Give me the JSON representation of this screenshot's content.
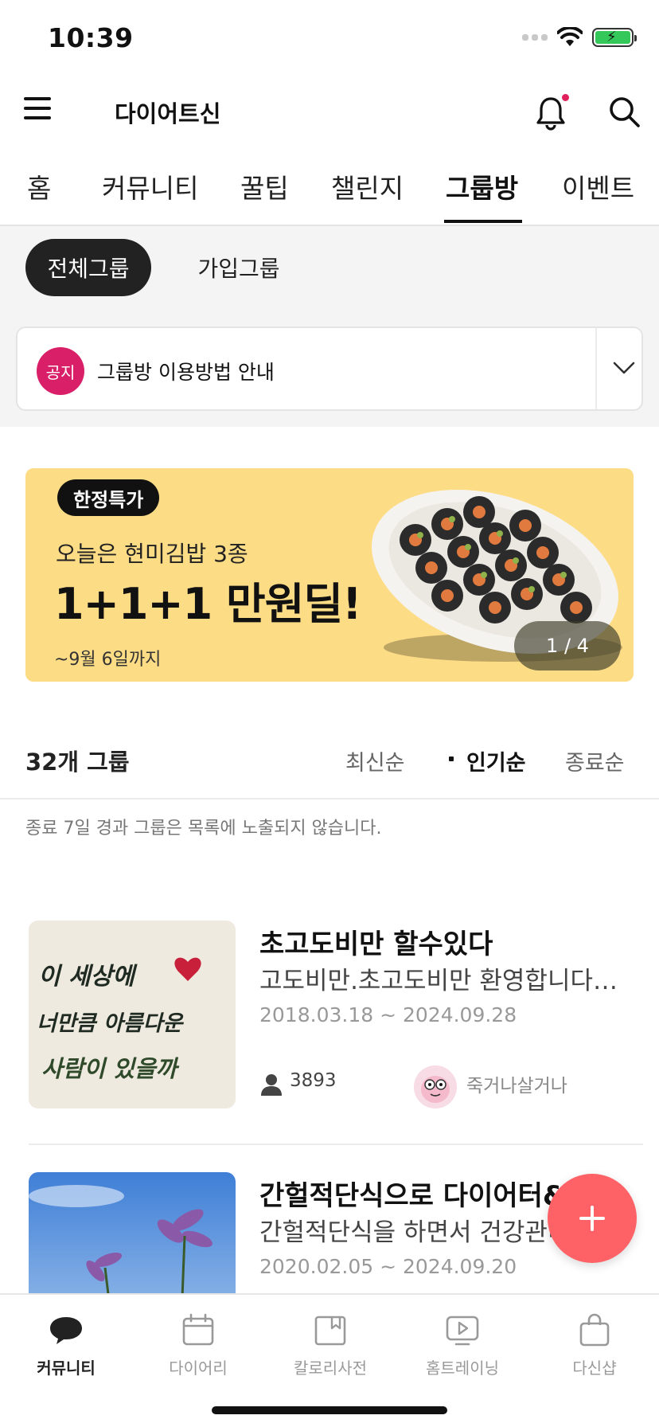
{
  "status_bar": {
    "time": "10:39"
  },
  "header": {
    "app_title": "다이어트신"
  },
  "main_tabs": [
    {
      "label": "홈"
    },
    {
      "label": "커뮤니티"
    },
    {
      "label": "꿀팁"
    },
    {
      "label": "챌린지"
    },
    {
      "label": "그룹방",
      "active": true
    },
    {
      "label": "이벤트"
    }
  ],
  "sub_tabs": [
    {
      "label": "전체그룹",
      "active": true
    },
    {
      "label": "가입그룹"
    }
  ],
  "notice": {
    "badge": "공지",
    "text": "그룹방 이용방법 안내"
  },
  "banner": {
    "tag": "한정특가",
    "subtitle": "오늘은 현미김밥 3종",
    "headline": "1+1+1 만원딜!",
    "date": "~9월 6일까지",
    "pager": "1 / 4",
    "color": "#fddc86"
  },
  "list": {
    "count": "32개 그룹",
    "sort_options": [
      {
        "label": "최신순"
      },
      {
        "label": "인기순",
        "active": true
      },
      {
        "label": "종료순"
      }
    ],
    "note": "종료 7일 경과 그룹은 목록에 노출되지 않습니다.",
    "groups": [
      {
        "title": "초고도비만 할수있다",
        "description": "고도비만.초고도비만 환영합니다…",
        "period": "2018.03.18 ~ 2024.09.28",
        "members": "3893",
        "owner": "죽거나살거나",
        "thumb_text": [
          "이 세상에",
          "너만큼 아름다운",
          "사람이 있을까"
        ]
      },
      {
        "title": "간헐적단식으로 다이어터&",
        "description": "간헐적단식을 하면서 건강관리",
        "period": "2020.02.05 ~ 2024.09.20"
      }
    ]
  },
  "fab": {
    "icon": "plus-icon",
    "color": "#ff6266"
  },
  "bottom_nav": [
    {
      "label": "커뮤니티",
      "icon": "chat-bubble-icon",
      "active": true
    },
    {
      "label": "다이어리",
      "icon": "calendar-icon"
    },
    {
      "label": "칼로리사전",
      "icon": "book-icon"
    },
    {
      "label": "홈트레이닝",
      "icon": "play-icon"
    },
    {
      "label": "다신샵",
      "icon": "shopping-bag-icon"
    }
  ],
  "colors": {
    "accent": "#d81f68",
    "fab": "#ff6266",
    "dark": "#222222"
  }
}
